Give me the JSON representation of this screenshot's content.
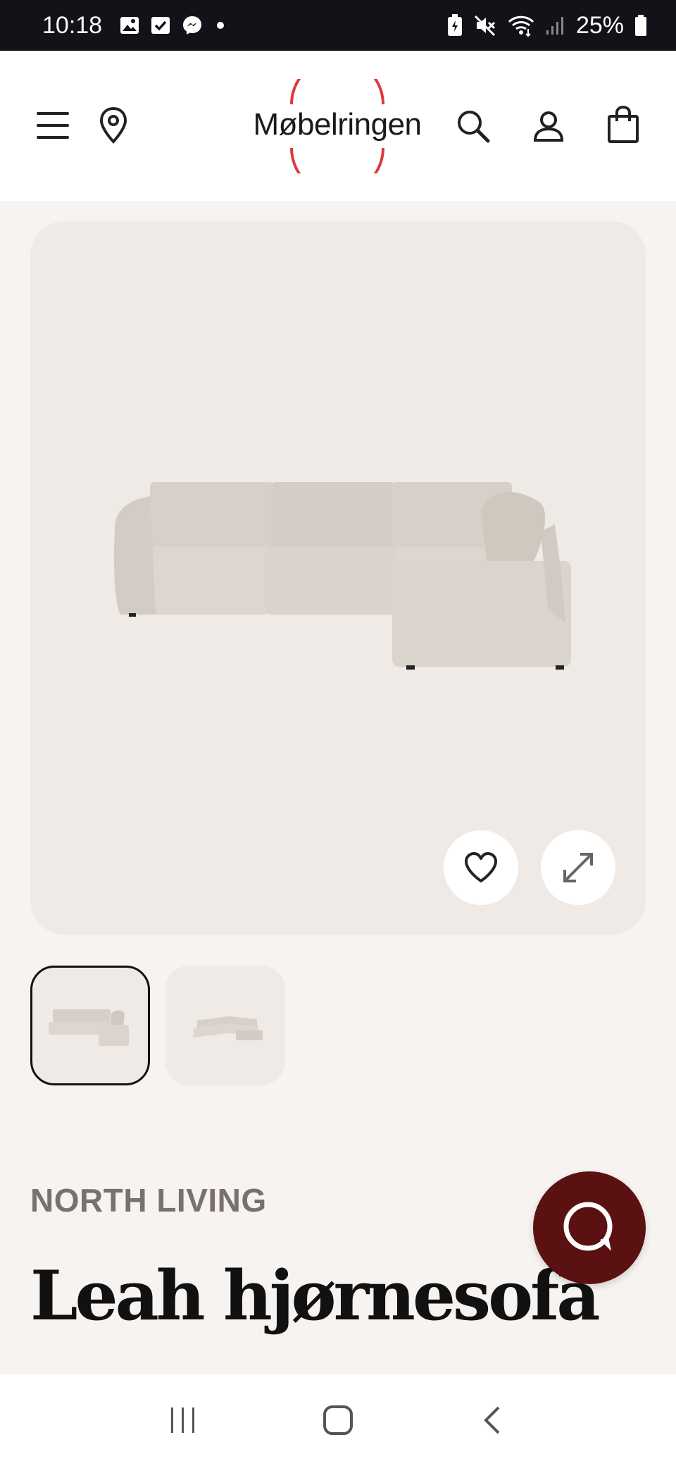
{
  "status_bar": {
    "time": "10:18",
    "battery": "25%",
    "left_icons": [
      "gallery-icon",
      "checkbox-icon",
      "messenger-icon",
      "dot-icon"
    ],
    "right_icons": [
      "battery-saver-icon",
      "mute-icon",
      "wifi-icon",
      "signal-icon",
      "battery-icon"
    ]
  },
  "header": {
    "logo": "Møbelringen",
    "icons": [
      "menu-icon",
      "location-pin-icon",
      "search-icon",
      "user-icon",
      "shopping-bag-icon"
    ]
  },
  "product": {
    "brand": "NORTH LIVING",
    "title": "Leah hjørnesofa",
    "actions": [
      "heart-icon",
      "expand-icon"
    ]
  },
  "colors": {
    "accent_red": "#e0383a",
    "chat_bg": "#5b1111",
    "image_bg": "#efeae5",
    "page_bg": "#f6f3f0"
  }
}
